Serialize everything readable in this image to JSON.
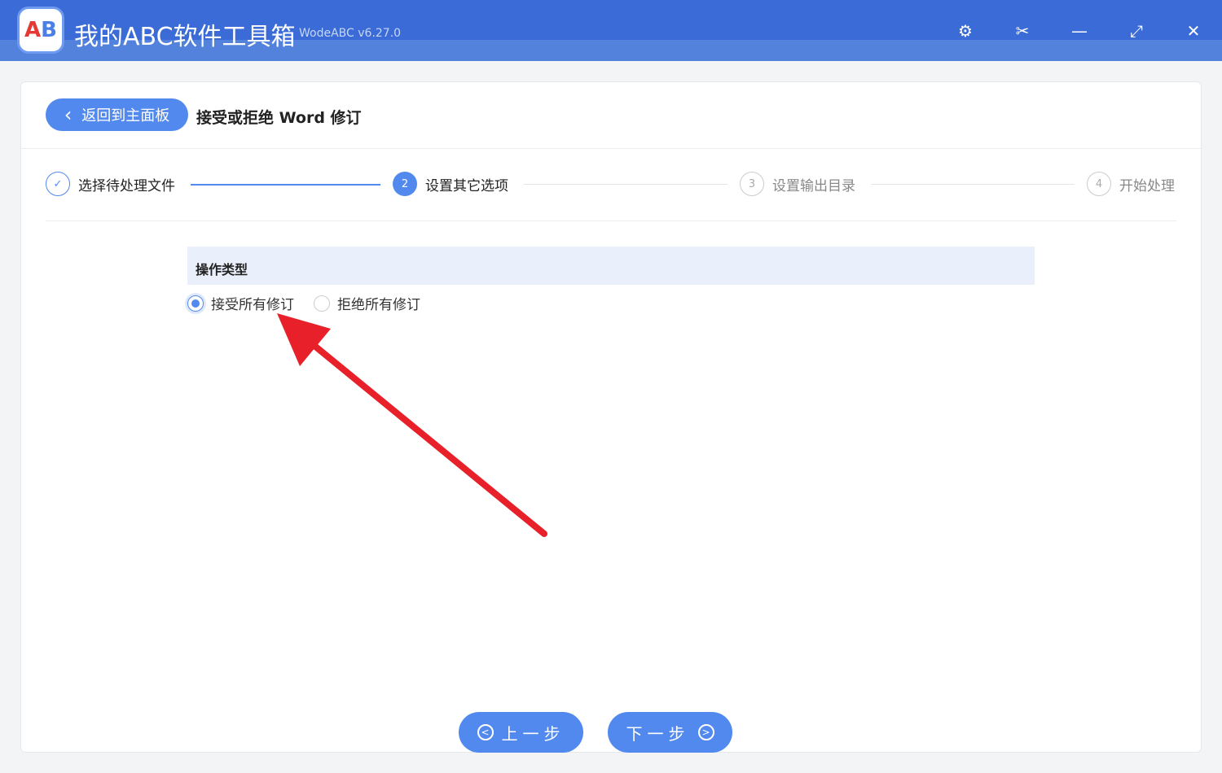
{
  "app": {
    "title": "我的ABC软件工具箱",
    "version": "WodeABC v6.27.0",
    "logo_text": "AB"
  },
  "controls": {
    "settings": "⚙",
    "cut": "✂",
    "minimize": "—",
    "maximize": "⤢",
    "close": "✕"
  },
  "header": {
    "back_label": "返回到主面板",
    "back_icon": "‹",
    "page_title": "接受或拒绝 Word 修订"
  },
  "steps": [
    {
      "index": "✓",
      "label": "选择待处理文件",
      "state": "done"
    },
    {
      "index": "2",
      "label": "设置其它选项",
      "state": "active"
    },
    {
      "index": "3",
      "label": "设置输出目录",
      "state": "pending"
    },
    {
      "index": "4",
      "label": "开始处理",
      "state": "pending"
    }
  ],
  "options": {
    "section_title": "操作类型",
    "radios": [
      {
        "label": "接受所有修订",
        "checked": true
      },
      {
        "label": "拒绝所有修订",
        "checked": false
      }
    ]
  },
  "footer": {
    "prev_label": "上一步",
    "next_label": "下一步",
    "prev_icon": "<",
    "next_icon": ">"
  },
  "colors": {
    "accent": "#5289ee",
    "titlebar": "#3a6bd6",
    "arrow": "#e8202a"
  }
}
